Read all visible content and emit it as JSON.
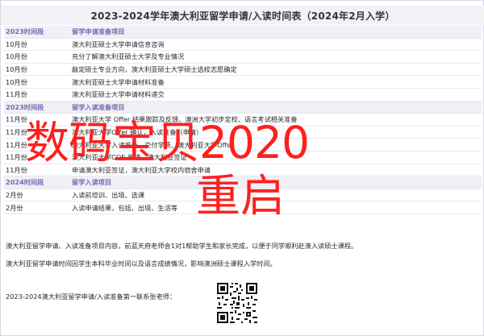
{
  "header": {
    "title": "2023-2024学年澳大利亚留学申请/入读时间表（2024年2月入学）"
  },
  "timeline": [
    {
      "time": "2023时间段",
      "desc": "留学申请准备项目",
      "section": true
    },
    {
      "time": "10月份",
      "desc": "澳大利亚硕士大学申请信息咨询",
      "section": false
    },
    {
      "time": "10月份",
      "desc": "充分了解澳大利亚硕士大学及专业情况",
      "section": false
    },
    {
      "time": "10月份",
      "desc": "敲定硕士专业方向，澳大利亚硕士大学硕士选校志愿确定",
      "section": false
    },
    {
      "time": "10月份",
      "desc": "澳大利亚硕士大学申请材料准备",
      "section": false
    },
    {
      "time": "11月份",
      "desc": "澳大利亚硕士大学申请材料递交",
      "section": false
    },
    {
      "time": "2023时间段",
      "desc": "留学入读准备项目",
      "section": true
    },
    {
      "time": "11月份",
      "desc": "澳大利亚大学 Offer 结果跟踪及反馈、澳洲大学初步定校、语言考试相关准备",
      "section": false
    },
    {
      "time": "11月份",
      "desc": "澳大利亚大学Offer 确认，入读准备（申请）",
      "section": false
    },
    {
      "time": "11月份",
      "desc": "澳大利亚大学入读准备，交付学费、澳大利亚大学Offer",
      "section": false
    },
    {
      "time": "11月份",
      "desc": "澳大利亚大学COE 申请，澳大利亚签证",
      "section": false
    },
    {
      "time": "11月份",
      "desc": "申请澳大利亚签证，澳大利亚大学校内宿舍申请",
      "section": false
    },
    {
      "time": "2024时间段",
      "desc": "留学入读项目",
      "section": true
    },
    {
      "time": "2月份",
      "desc": "入读前培训、出境、选课",
      "section": false
    },
    {
      "time": "2月份",
      "desc": "入读申请结果，包括、出境、生活等",
      "section": false
    }
  ],
  "overlay": {
    "main": "数码宝贝2020",
    "sub": "重启"
  },
  "notes": [
    "澳大利亚留学申请、入读准备项目内容，前蓝天府老师会1对1帮助学生和家长完成，以便于同学顺利赴澳入读硕士课程。",
    "澳大利亚留学申请时间因学生本科毕业时间以及语言成绩情况，影响澳洲硕士课程入学时间。"
  ],
  "footer": {
    "text": "2023-2024澳大利亚留学申请/入读准备第一联系张老师："
  },
  "colors": {
    "accent": "#7b69b0",
    "overlay": "#ff1f1f",
    "header_bg": "#f2f1f6"
  }
}
